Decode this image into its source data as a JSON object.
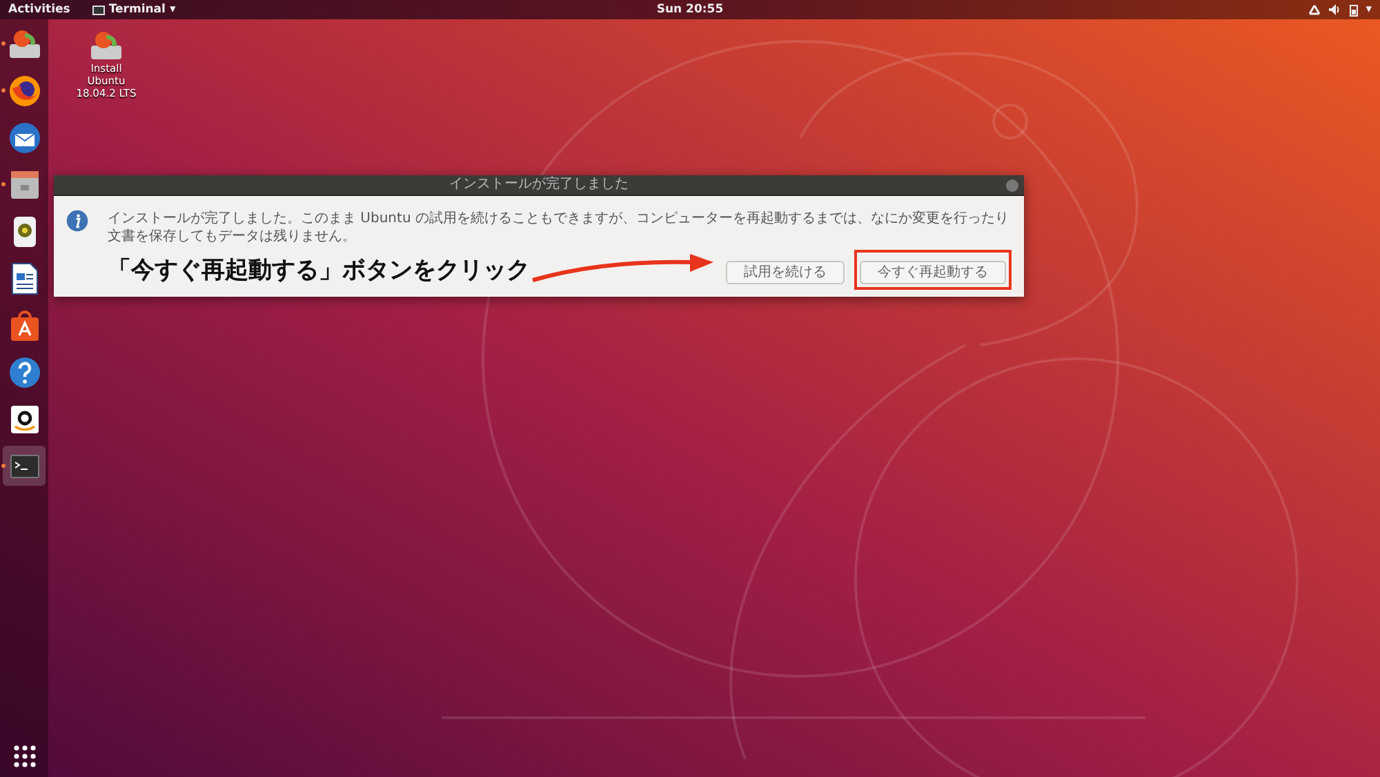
{
  "top_bar": {
    "activities": "Activities",
    "app_menu": {
      "label": "Terminal",
      "caret": "▾"
    },
    "clock": "Sun 20:55",
    "tray_caret": "▾"
  },
  "dock": {
    "items": [
      {
        "kind": "installer",
        "running": true,
        "selected": false
      },
      {
        "kind": "browser",
        "running": true,
        "selected": false
      },
      {
        "kind": "mail",
        "running": false,
        "selected": false
      },
      {
        "kind": "files",
        "running": true,
        "selected": false
      },
      {
        "kind": "audio",
        "running": false,
        "selected": false
      },
      {
        "kind": "writer",
        "running": false,
        "selected": false
      },
      {
        "kind": "software",
        "running": false,
        "selected": false
      },
      {
        "kind": "help",
        "running": false,
        "selected": false
      },
      {
        "kind": "shop",
        "running": false,
        "selected": false
      },
      {
        "kind": "terminal",
        "running": true,
        "selected": true
      }
    ]
  },
  "desktop_icon": {
    "label_lines": [
      "Install",
      "Ubuntu",
      "18.04.2 LTS"
    ]
  },
  "dialog": {
    "title": "インストールが完了しました",
    "message": "インストールが完了しました。このまま Ubuntu の試用を続けることもできますが、コンピューターを再起動するまでは、なにか変更を行ったり文書を保存してもデータは残りません。",
    "buttons": [
      {
        "label": "試用を続ける",
        "highlighted": false
      },
      {
        "label": "今すぐ再起動する",
        "highlighted": true
      }
    ]
  },
  "annotation": "「今すぐ再起動する」ボタンをクリック"
}
